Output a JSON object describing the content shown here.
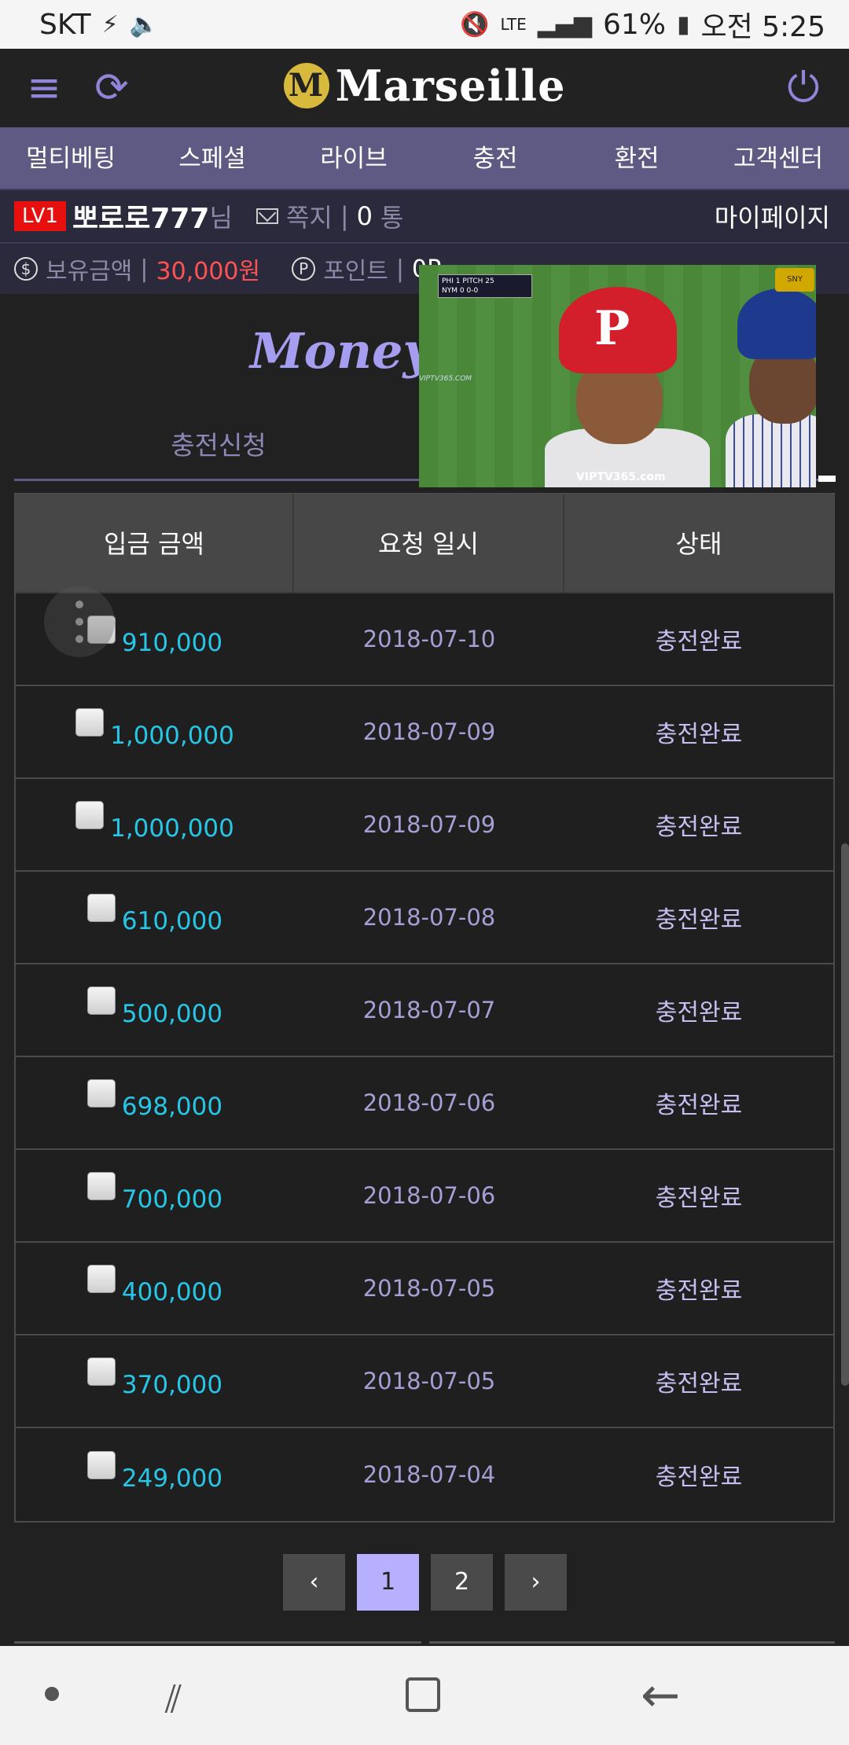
{
  "status_bar": {
    "carrier": "SKT",
    "battery": "61%",
    "time": "오전 5:25",
    "network": "LTE"
  },
  "header": {
    "logo_text": "Marseille",
    "logo_mark": "M"
  },
  "nav": {
    "items": [
      "멀티베팅",
      "스페셜",
      "라이브",
      "충전",
      "환전",
      "고객센터"
    ]
  },
  "user": {
    "level": "LV1",
    "name": "뽀로로777",
    "suffix": "님",
    "message_label": "쪽지",
    "message_count": "0",
    "message_unit": "통",
    "mypage": "마이페이지"
  },
  "balance": {
    "label": "보유금액",
    "amount": "30,000원",
    "point_label": "포인트",
    "point_value": "0P"
  },
  "page_title": "Money ch",
  "tab": {
    "active_label": "충전신청"
  },
  "video": {
    "watermark": "VIPTV365.com",
    "watermark_small": "VIPTV365.COM",
    "score_line1": "PHI 1",
    "score_line2": "NYM 0",
    "score_pitch": "PITCH 25",
    "score_count": "0-0"
  },
  "table": {
    "headers": [
      "입금 금액",
      "요청 일시",
      "상태"
    ],
    "rows": [
      {
        "amount": "910,000",
        "date": "2018-07-10",
        "status": "충전완료"
      },
      {
        "amount": "1,000,000",
        "date": "2018-07-09",
        "status": "충전완료"
      },
      {
        "amount": "1,000,000",
        "date": "2018-07-09",
        "status": "충전완료"
      },
      {
        "amount": "610,000",
        "date": "2018-07-08",
        "status": "충전완료"
      },
      {
        "amount": "500,000",
        "date": "2018-07-07",
        "status": "충전완료"
      },
      {
        "amount": "698,000",
        "date": "2018-07-06",
        "status": "충전완료"
      },
      {
        "amount": "700,000",
        "date": "2018-07-06",
        "status": "충전완료"
      },
      {
        "amount": "400,000",
        "date": "2018-07-05",
        "status": "충전완료"
      },
      {
        "amount": "370,000",
        "date": "2018-07-05",
        "status": "충전완료"
      },
      {
        "amount": "249,000",
        "date": "2018-07-04",
        "status": "충전완료"
      }
    ]
  },
  "pagination": {
    "prev": "‹",
    "pages": [
      "1",
      "2"
    ],
    "current": "1",
    "next": "›"
  }
}
